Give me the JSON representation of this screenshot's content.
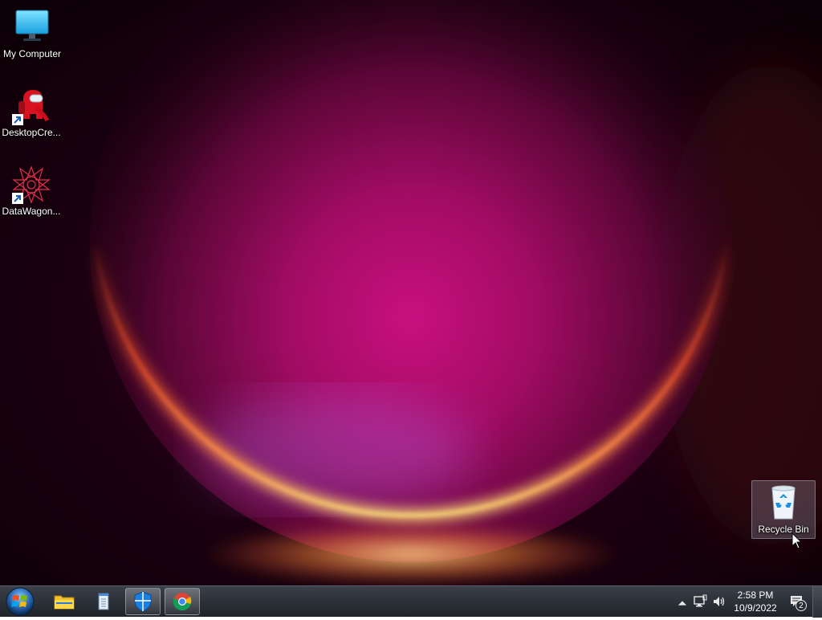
{
  "desktop": {
    "icons": [
      {
        "label": "My Computer",
        "icon": "monitor-icon"
      },
      {
        "label": "DesktopCre...",
        "icon": "among-us-crewmate-icon"
      },
      {
        "label": "DataWagon...",
        "icon": "mandala-icon"
      },
      {
        "label": "Recycle Bin",
        "icon": "recycle-bin-icon"
      }
    ]
  },
  "taskbar": {
    "start_icon": "windows-orb-icon",
    "pinned": [
      {
        "name": "File Explorer",
        "icon": "folder-icon"
      },
      {
        "name": "Notepad",
        "icon": "notepad-icon"
      },
      {
        "name": "Windows Security",
        "icon": "shield-icon"
      },
      {
        "name": "Google Chrome",
        "icon": "chrome-icon"
      }
    ],
    "tray": {
      "show_hidden_icon": "chevron-up-icon",
      "network_icon": "network-icon",
      "volume_icon": "speaker-icon",
      "time": "2:58 PM",
      "date": "10/9/2022",
      "notification_count": "2"
    }
  },
  "colors": {
    "taskbar": "#2a2e35",
    "wallpaper_core": "#c0107a",
    "wallpaper_rim": "#ff8a2a",
    "shield": "#1a7fe0"
  }
}
